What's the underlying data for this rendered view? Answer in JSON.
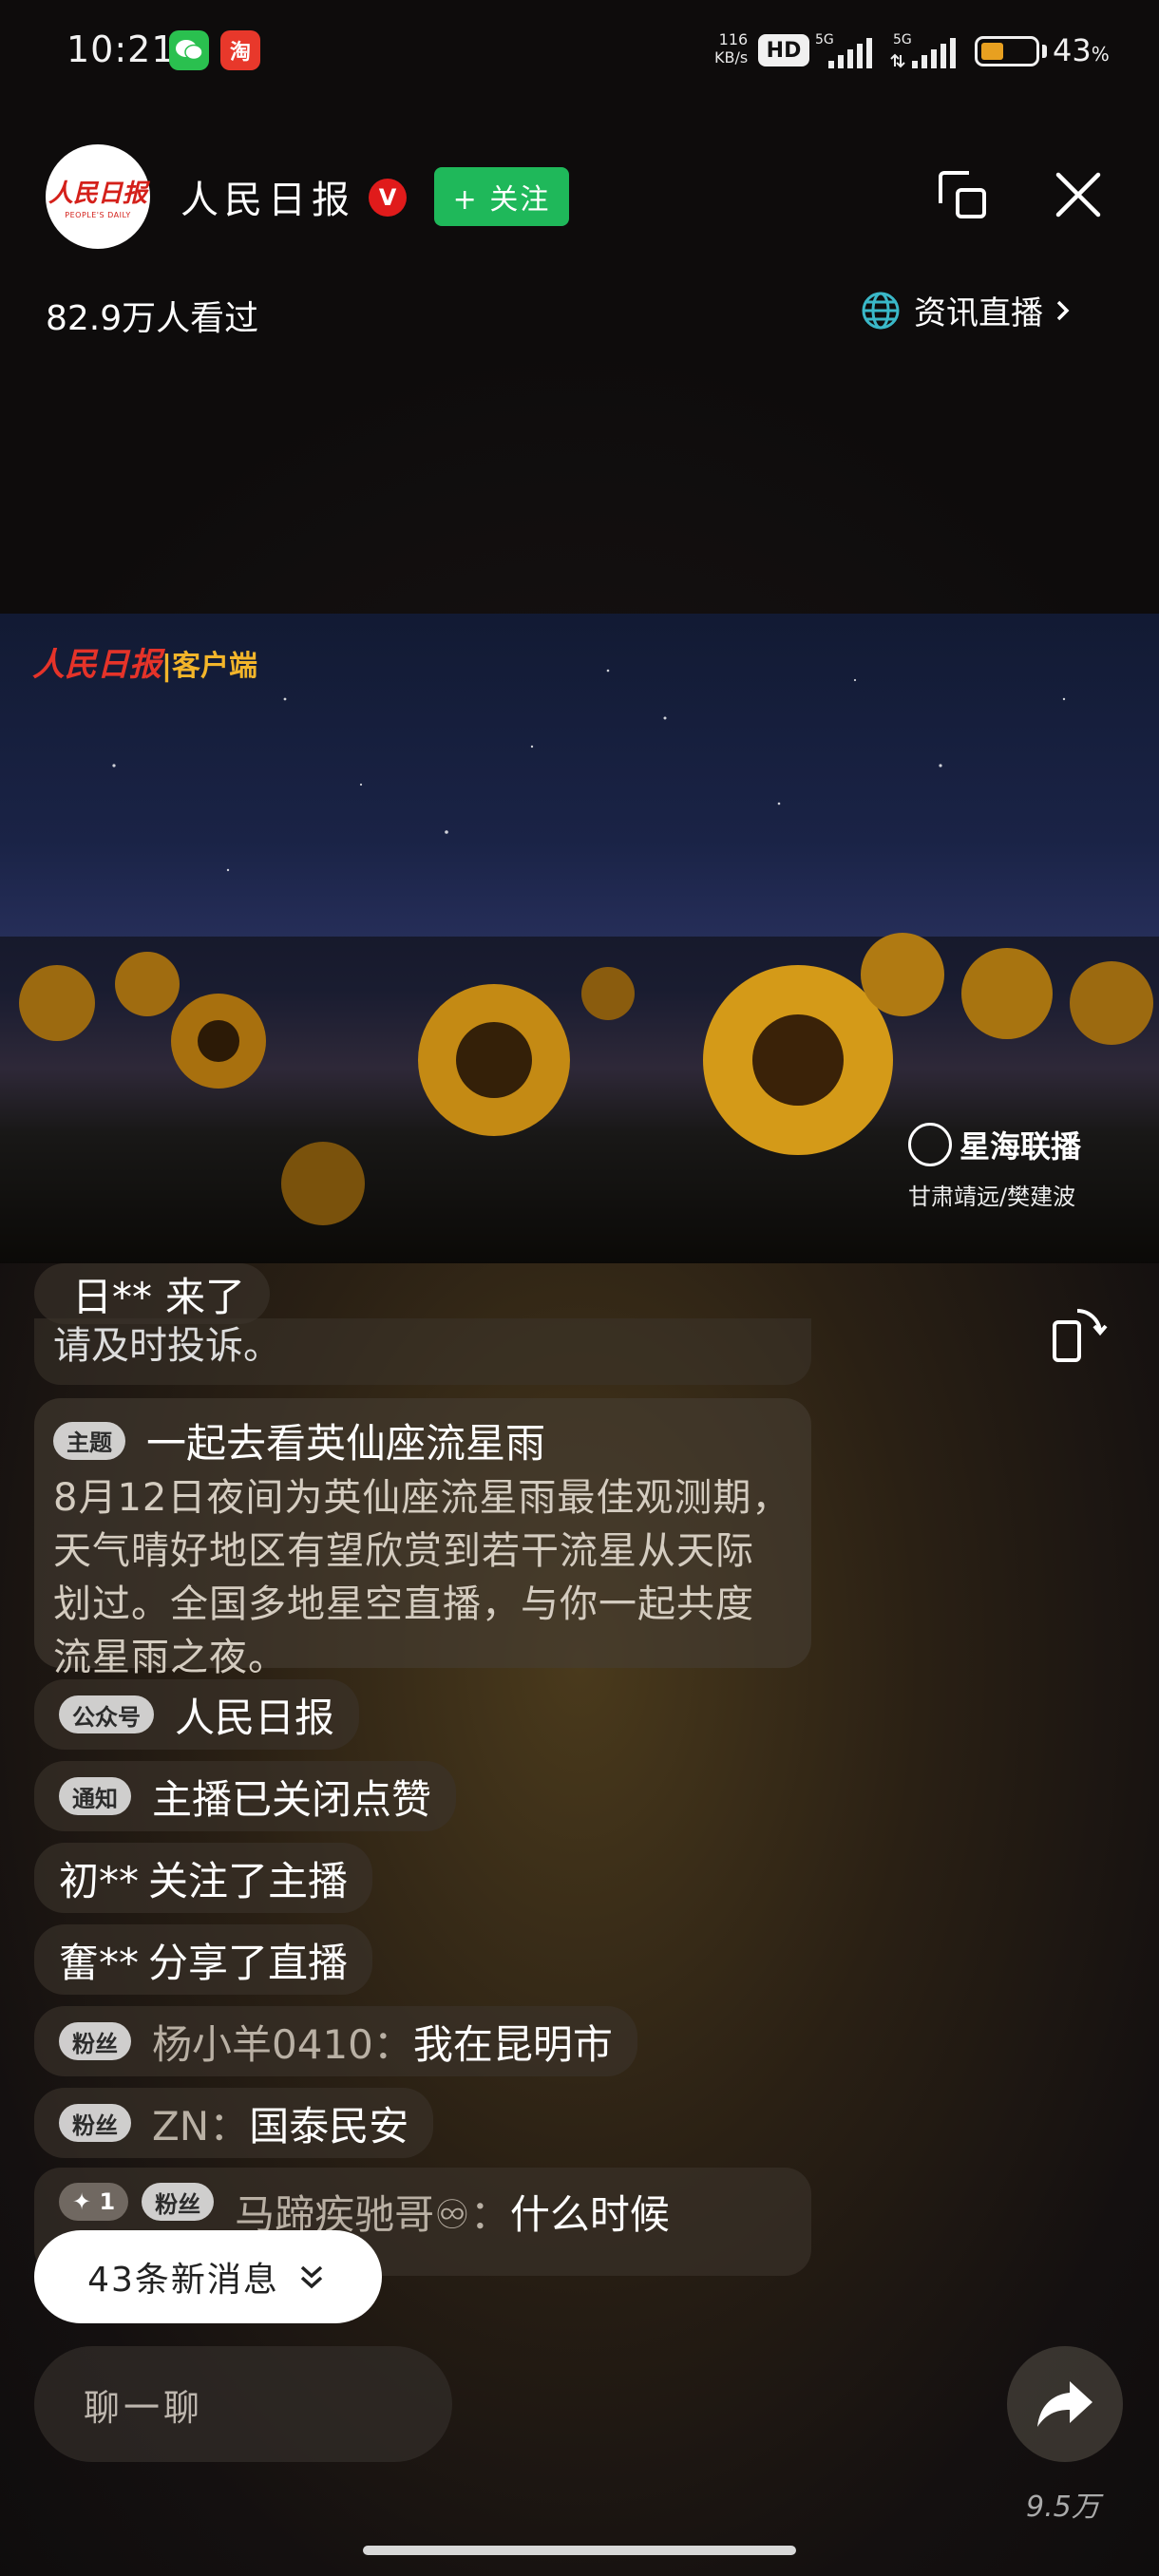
{
  "status_bar": {
    "time": "10:21",
    "net_speed_value": "116",
    "net_speed_unit": "KB/s",
    "hd_label": "HD",
    "network_1": "5G",
    "network_2": "5G",
    "battery_percent": "43",
    "battery_suffix": "%",
    "battery_level": 0.43,
    "notification_icons": [
      "wechat-icon",
      "taobao-icon"
    ],
    "taobao_glyph": "淘"
  },
  "header": {
    "avatar_logo": "人民日报",
    "avatar_sub": "PEOPLE'S DAILY",
    "host_name": "人民日报",
    "verified_badge": "V",
    "follow_label": "+ 关注",
    "viewers": "82.9万人看过",
    "channel_label": "资讯直播"
  },
  "video": {
    "watermark_left": "人民日报",
    "watermark_left_suffix": "客户端",
    "watermark_right": "星海联播",
    "watermark_right_sub": "甘肃靖远/樊建波"
  },
  "chat": {
    "entry": {
      "user": "日**",
      "text": "来了"
    },
    "clipped_text": "请及时投诉。",
    "topic": {
      "tag": "主题",
      "title": "一起去看英仙座流星雨",
      "body": "8月12日夜间为英仙座流星雨最佳观测期，天气晴好地区有望欣赏到若干流星从天际划过。全国多地星空直播，与你一起共度流星雨之夜。"
    },
    "messages": [
      {
        "tag": "公众号",
        "user": "",
        "text": "人民日报"
      },
      {
        "tag": "通知",
        "user": "",
        "text": "主播已关闭点赞"
      },
      {
        "tag": "",
        "user": "初**",
        "text": "关注了主播"
      },
      {
        "tag": "",
        "user": "奮**",
        "text": "分享了直播"
      },
      {
        "tag": "粉丝",
        "user": "杨小羊0410：",
        "text": "我在昆明市"
      },
      {
        "tag": "粉丝",
        "user": "ZN：",
        "text": "国泰民安"
      },
      {
        "level": "✦ 1",
        "tag": "粉丝",
        "user": "马蹄疾驰哥♾：",
        "text": "什么时候"
      }
    ]
  },
  "new_messages_label": "43条新消息",
  "input_placeholder": "聊一聊",
  "share_count": "9.5万",
  "colors": {
    "follow": "#1fb85a",
    "verified": "#e01b1b",
    "brand_red": "#d4201a"
  }
}
